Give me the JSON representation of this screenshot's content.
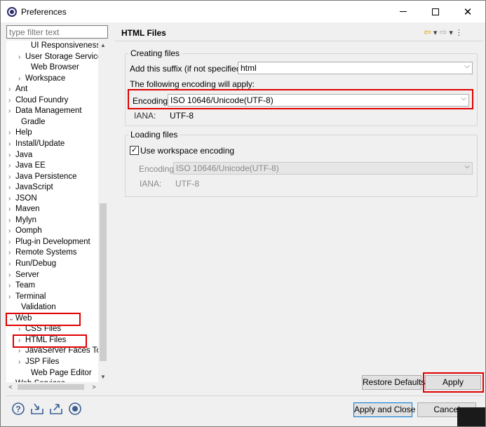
{
  "window": {
    "title": "Preferences"
  },
  "filter": {
    "placeholder": "type filter text"
  },
  "tree": {
    "rows": [
      {
        "label": "UI Responsiveness M",
        "arrow": "",
        "indent": 2
      },
      {
        "label": "User Storage Service",
        "arrow": ">",
        "indent": 1
      },
      {
        "label": "Web Browser",
        "arrow": "",
        "indent": 2
      },
      {
        "label": "Workspace",
        "arrow": ">",
        "indent": 1
      },
      {
        "label": "Ant",
        "arrow": ">",
        "indent": 0
      },
      {
        "label": "Cloud Foundry",
        "arrow": ">",
        "indent": 0
      },
      {
        "label": "Data Management",
        "arrow": ">",
        "indent": 0
      },
      {
        "label": "Gradle",
        "arrow": "",
        "indent": 1
      },
      {
        "label": "Help",
        "arrow": ">",
        "indent": 0
      },
      {
        "label": "Install/Update",
        "arrow": ">",
        "indent": 0
      },
      {
        "label": "Java",
        "arrow": ">",
        "indent": 0
      },
      {
        "label": "Java EE",
        "arrow": ">",
        "indent": 0
      },
      {
        "label": "Java Persistence",
        "arrow": ">",
        "indent": 0
      },
      {
        "label": "JavaScript",
        "arrow": ">",
        "indent": 0
      },
      {
        "label": "JSON",
        "arrow": ">",
        "indent": 0
      },
      {
        "label": "Maven",
        "arrow": ">",
        "indent": 0
      },
      {
        "label": "Mylyn",
        "arrow": ">",
        "indent": 0
      },
      {
        "label": "Oomph",
        "arrow": ">",
        "indent": 0
      },
      {
        "label": "Plug-in Development",
        "arrow": ">",
        "indent": 0
      },
      {
        "label": "Remote Systems",
        "arrow": ">",
        "indent": 0
      },
      {
        "label": "Run/Debug",
        "arrow": ">",
        "indent": 0
      },
      {
        "label": "Server",
        "arrow": ">",
        "indent": 0
      },
      {
        "label": "Team",
        "arrow": ">",
        "indent": 0
      },
      {
        "label": "Terminal",
        "arrow": ">",
        "indent": 0
      },
      {
        "label": "Validation",
        "arrow": "",
        "indent": 1
      },
      {
        "label": "Web",
        "arrow": "v",
        "indent": 0
      },
      {
        "label": "CSS Files",
        "arrow": ">",
        "indent": 1
      },
      {
        "label": "HTML Files",
        "arrow": ">",
        "indent": 1
      },
      {
        "label": "JavaServer Faces Too",
        "arrow": ">",
        "indent": 1
      },
      {
        "label": "JSP Files",
        "arrow": ">",
        "indent": 1
      },
      {
        "label": "Web Page Editor",
        "arrow": "",
        "indent": 2
      },
      {
        "label": "Web Services",
        "arrow": ">",
        "indent": 0
      }
    ]
  },
  "page": {
    "title": "HTML Files",
    "creating": {
      "group_label": "Creating files",
      "suffix_label": "Add this suffix (if not specified):",
      "suffix_value": "html",
      "following_label": "The following encoding will apply:",
      "encoding_label": "Encoding:",
      "encoding_value": "ISO 10646/Unicode(UTF-8)",
      "iana_label": "IANA:",
      "iana_value": "UTF-8"
    },
    "loading": {
      "group_label": "Loading files",
      "workspace_checkbox_label": "Use workspace encoding",
      "workspace_checked": true,
      "encoding_label": "Encoding",
      "encoding_value": "ISO 10646/Unicode(UTF-8)",
      "iana_label": "IANA:",
      "iana_value": "UTF-8"
    },
    "restore_defaults": "Restore Defaults",
    "apply": "Apply"
  },
  "footer": {
    "apply_and_close": "Apply and Close",
    "cancel": "Cancel"
  },
  "colors": {
    "highlight": "#e00000",
    "default_button_border": "#0078d7"
  }
}
